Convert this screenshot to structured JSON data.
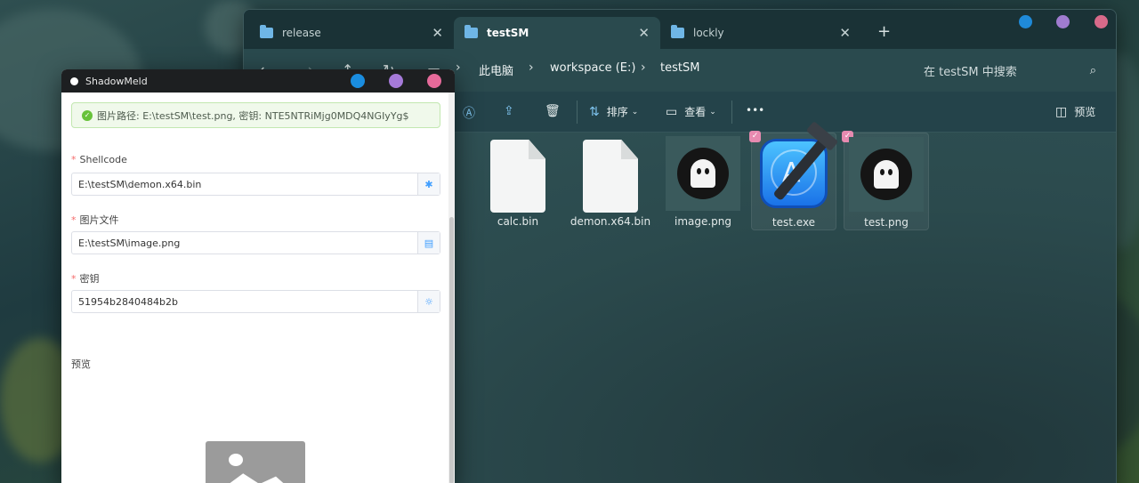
{
  "explorer": {
    "tabs": [
      {
        "label": "release",
        "close": "✕"
      },
      {
        "label": "testSM",
        "close": "✕"
      },
      {
        "label": "lockly",
        "close": "✕"
      }
    ],
    "new_tab": "+",
    "breadcrumb": [
      "此电脑",
      "workspace (E:)",
      "testSM"
    ],
    "search_placeholder": "在 testSM 中搜索",
    "toolbar": {
      "sort_label": "排序",
      "view_label": "查看",
      "more_label": "•••",
      "preview_label": "预览"
    },
    "files": [
      {
        "name": "calc.bin",
        "icon": "document-icon",
        "checked": false
      },
      {
        "name": "demon.x64.bin",
        "icon": "document-icon",
        "checked": false
      },
      {
        "name": "image.png",
        "icon": "ghost-image-icon",
        "checked": false
      },
      {
        "name": "test.exe",
        "icon": "xcode-app-icon",
        "checked": true
      },
      {
        "name": "test.png",
        "icon": "ghost-image-icon",
        "checked": true
      }
    ],
    "window_dot_colors": [
      "#1f8ad8",
      "#a07cd0",
      "#d86a8a"
    ]
  },
  "app": {
    "title": "ShadowMeld",
    "window_dot_colors": [
      "#1a8de0",
      "#a57ad8",
      "#e66a9a"
    ],
    "alert_text": "图片路径: E:\\testSM\\test.png, 密钥: NTE5NTRiMjg0MDQ4NGIyYg$",
    "fields": [
      {
        "label": "Shellcode",
        "value": "E:\\testSM\\demon.x64.bin",
        "suffix_icon": "bug-icon"
      },
      {
        "label": "图片文件",
        "value": "E:\\testSM\\image.png",
        "suffix_icon": "file-icon"
      },
      {
        "label": "密钥",
        "value": "51954b2840484b2b",
        "suffix_icon": "bulb-icon"
      }
    ],
    "required_mark": "*",
    "preview_label": "预览"
  }
}
